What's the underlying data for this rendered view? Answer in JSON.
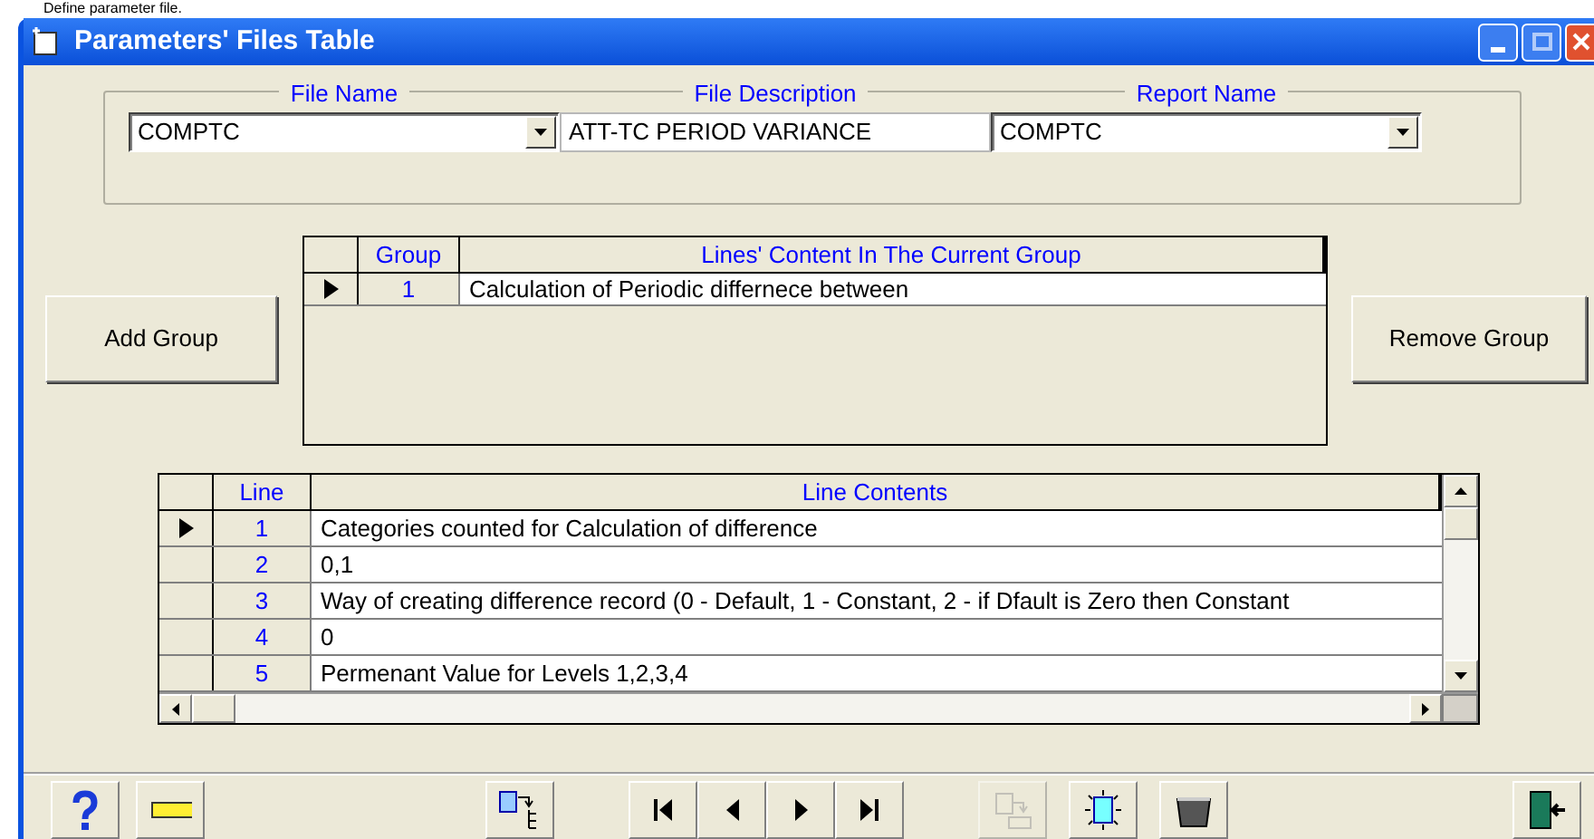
{
  "caption": "Define parameter file.",
  "window": {
    "title": "Parameters' Files Table"
  },
  "file_fields": [
    {
      "label": "File Name",
      "value": "COMPTC",
      "kind": "dropdown"
    },
    {
      "label": "File Description",
      "value": "ATT-TC PERIOD VARIANCE",
      "kind": "text"
    },
    {
      "label": "Report Name",
      "value": "COMPTC",
      "kind": "dropdown"
    }
  ],
  "add_button": "Add Group",
  "remove_button": "Remove Group",
  "groups_table": {
    "columns": [
      "Group",
      "Lines' Content In The Current Group"
    ],
    "rows": [
      {
        "group": "1",
        "content": "Calculation of Periodic differnece between",
        "selected": true
      }
    ]
  },
  "lines_table": {
    "columns": [
      "Line",
      "Line Contents"
    ],
    "rows": [
      {
        "line": "1",
        "content": "Categories counted for Calculation of difference",
        "selected": true
      },
      {
        "line": "2",
        "content": "0,1",
        "selected": false
      },
      {
        "line": "3",
        "content": "Way of creating difference record (0 - Default, 1 - Constant, 2 - if Dfault is Zero then Constant",
        "selected": false
      },
      {
        "line": "4",
        "content": "0",
        "selected": false
      },
      {
        "line": "5",
        "content": "Permenant Value for Levels 1,2,3,4",
        "selected": false
      }
    ]
  },
  "toolbar": [
    {
      "kind": "help",
      "disabled": false
    },
    {
      "kind": "ruler",
      "disabled": false
    },
    {
      "kind": "export",
      "disabled": false
    },
    {
      "kind": "first",
      "disabled": false
    },
    {
      "kind": "prev",
      "disabled": false
    },
    {
      "kind": "next",
      "disabled": false
    },
    {
      "kind": "last",
      "disabled": false
    },
    {
      "kind": "copy",
      "disabled": true
    },
    {
      "kind": "new",
      "disabled": false
    },
    {
      "kind": "basket",
      "disabled": false
    },
    {
      "kind": "exit",
      "disabled": false
    }
  ]
}
